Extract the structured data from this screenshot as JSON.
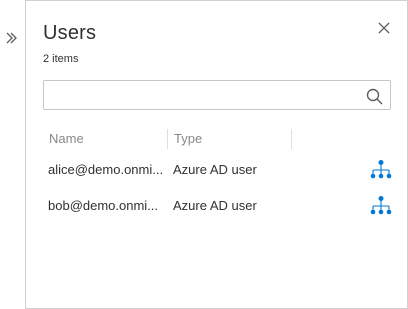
{
  "panel": {
    "title": "Users",
    "count_text": "2 items"
  },
  "search": {
    "value": "",
    "placeholder": ""
  },
  "table": {
    "columns": [
      "Name",
      "Type"
    ],
    "rows": [
      {
        "name": "alice@demo.onmi...",
        "type": "Azure AD user",
        "icon": "hierarchy-icon"
      },
      {
        "name": "bob@demo.onmi...",
        "type": "Azure AD user",
        "icon": "hierarchy-icon"
      }
    ]
  },
  "icons": {
    "collapse": "double-chevron-right-icon",
    "close": "close-icon",
    "search": "search-icon"
  },
  "colors": {
    "accent": "#0078d4",
    "border": "#d2d0ce",
    "muted_text": "#8a8886"
  }
}
